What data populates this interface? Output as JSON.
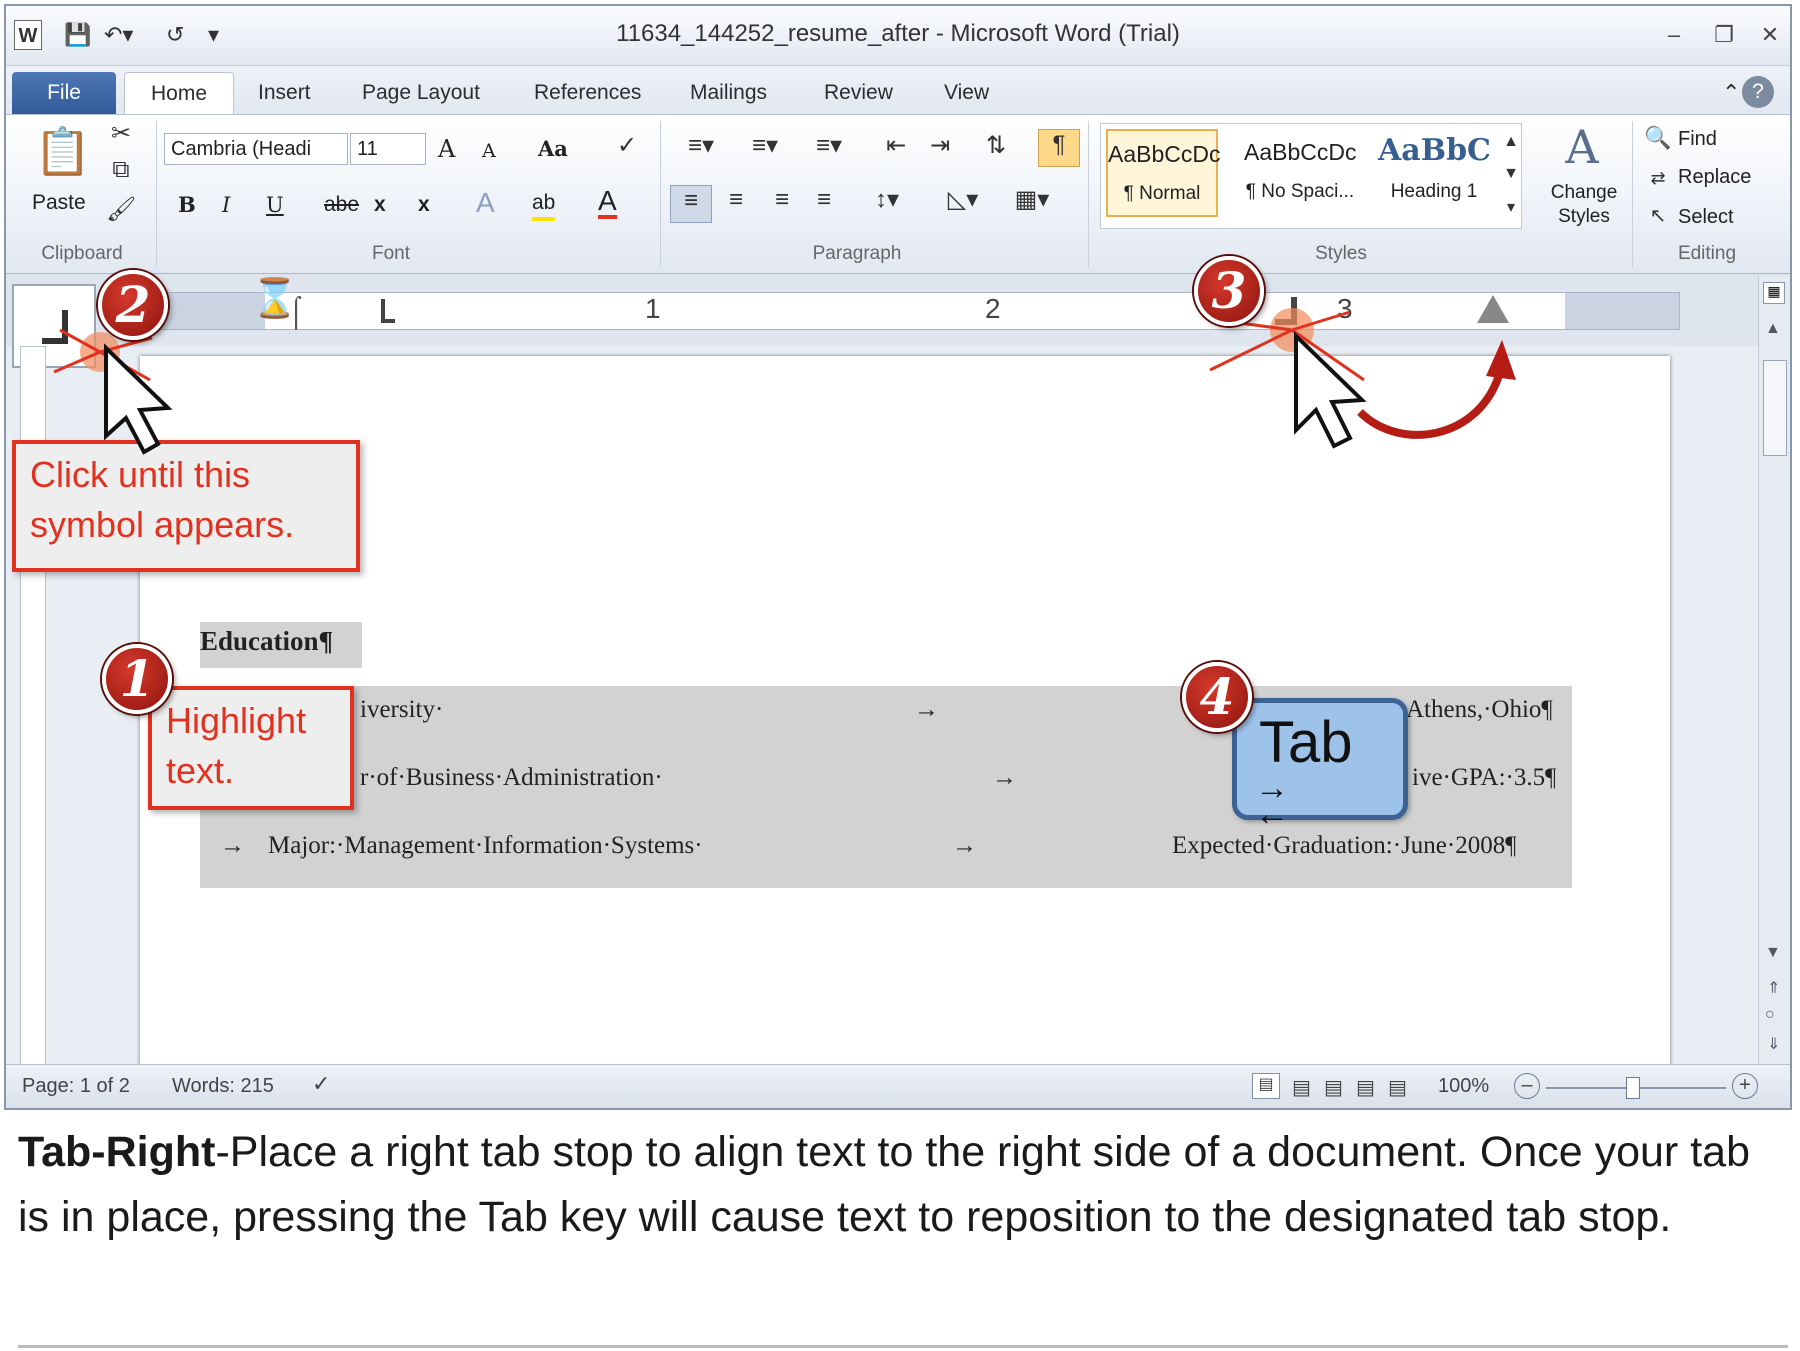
{
  "window": {
    "title": "11634_144252_resume_after  -  Microsoft Word (Trial)",
    "app_icon": "W"
  },
  "tabs": [
    "File",
    "Home",
    "Insert",
    "Page Layout",
    "References",
    "Mailings",
    "Review",
    "View"
  ],
  "ribbon": {
    "clipboard": {
      "paste": "Paste",
      "label": "Clipboard"
    },
    "font": {
      "name": "Cambria (Headi",
      "size": "11",
      "label": "Font",
      "grow": "A",
      "shrink": "A",
      "change_case": "Aa",
      "bold": "B",
      "italic": "I",
      "underline": "U",
      "strike": "abe",
      "subscript": "x",
      "superscript": "x",
      "text_effects": "A",
      "highlight": "ab",
      "color": "A"
    },
    "paragraph": {
      "label": "Paragraph"
    },
    "styles": {
      "label": "Styles",
      "items": [
        {
          "sample": "AaBbCcDc",
          "name": "¶ Normal"
        },
        {
          "sample": "AaBbCcDc",
          "name": "¶ No Spaci..."
        },
        {
          "sample": "AaBbC",
          "name": "Heading 1"
        }
      ],
      "change_styles": [
        "Change",
        "Styles"
      ]
    },
    "editing": {
      "label": "Editing",
      "find": "Find",
      "replace": "Replace",
      "select": "Select"
    }
  },
  "ruler": {
    "numbers": [
      "1",
      "2",
      "3"
    ]
  },
  "document": {
    "heading": "Education¶",
    "lines": [
      {
        "left": "iversity·",
        "arrow": "→",
        "right": "Athens,·Ohio¶"
      },
      {
        "left": "r·of·Business·Administration·",
        "arrow": "→",
        "right": "ive·GPA:·3.5¶"
      },
      {
        "lead": "→",
        "left": "Major:·Management·Information·Systems·",
        "arrow": "→",
        "right": "Expected·Graduation:·June·2008¶"
      }
    ]
  },
  "statusbar": {
    "page": "Page: 1 of 2",
    "words": "Words: 215",
    "zoom": "100%"
  },
  "callouts": {
    "step1": [
      "Highlight",
      "text."
    ],
    "step2": [
      "Click until this",
      "symbol appears."
    ],
    "tab_key": "Tab"
  },
  "badges": [
    "1",
    "2",
    "3",
    "4"
  ],
  "caption": {
    "bold": "Tab-Right",
    "text": "-Place a right tab stop to align text to the right side of a document. Once your tab is in place, pressing the Tab key will cause text to reposition to the designated tab stop."
  },
  "colors": {
    "accent": "#e0321f",
    "file_tab": "#2f5997",
    "tab_key": "#9ec3ea"
  }
}
